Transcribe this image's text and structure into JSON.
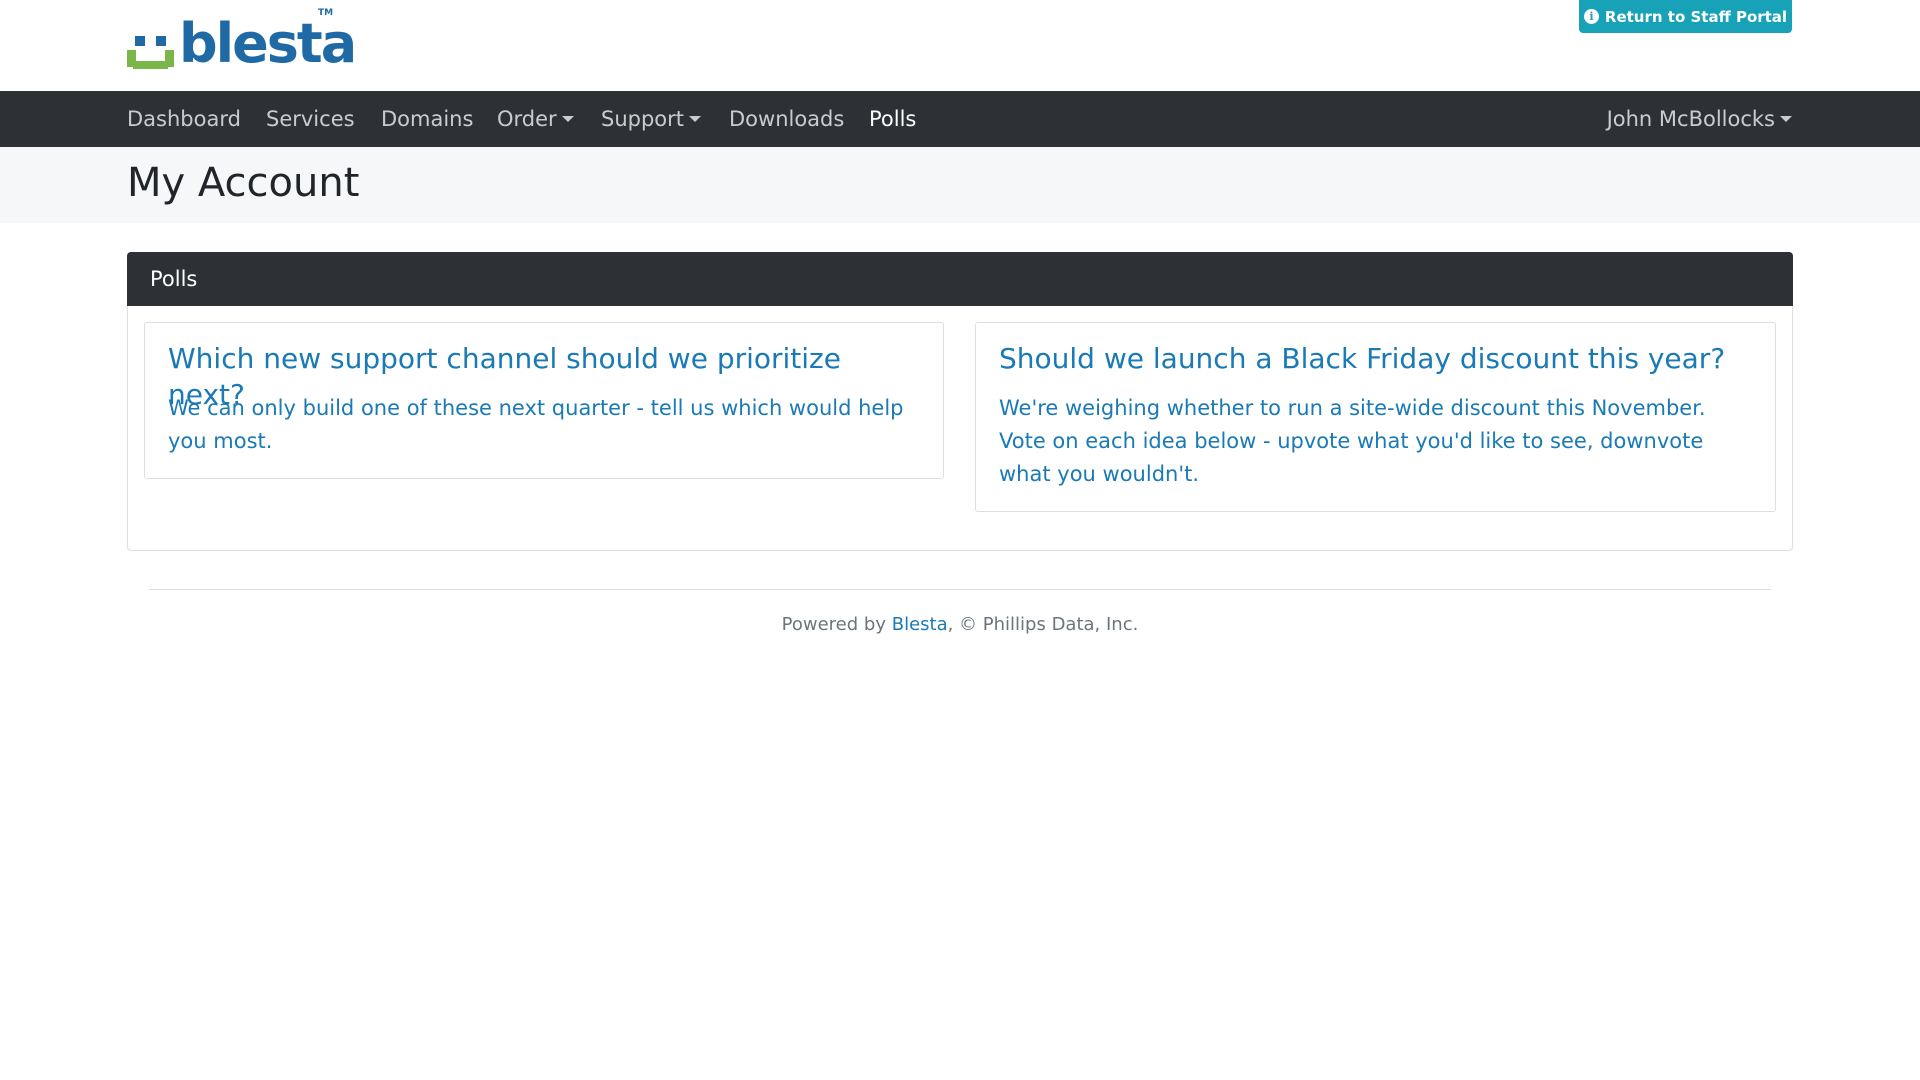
{
  "brand": {
    "name": "blesta",
    "trademark": "TM"
  },
  "header": {
    "staff_button_label": "Return to Staff Portal",
    "staff_button_icon": "info-circle-icon"
  },
  "nav": {
    "items": [
      {
        "label": "Dashboard",
        "dropdown": false,
        "active": false
      },
      {
        "label": "Services",
        "dropdown": false,
        "active": false
      },
      {
        "label": "Domains",
        "dropdown": false,
        "active": false
      },
      {
        "label": "Order",
        "dropdown": true,
        "active": false
      },
      {
        "label": "Support",
        "dropdown": true,
        "active": false
      },
      {
        "label": "Downloads",
        "dropdown": false,
        "active": false
      },
      {
        "label": "Polls",
        "dropdown": false,
        "active": true
      }
    ],
    "user_menu": "John McBollocks"
  },
  "page": {
    "title": "My Account"
  },
  "panel": {
    "title": "Polls",
    "polls": [
      {
        "question": "Which new support channel should we prioritize next?",
        "description": "We can only build one of these next quarter - tell us which would help you most."
      },
      {
        "question": "Should we launch a Black Friday discount this year?",
        "description": "We're weighing whether to run a site-wide discount this November. Vote on each idea below - upvote what you'd like to see, downvote what you wouldn't."
      }
    ]
  },
  "footer": {
    "prefix": "Powered by ",
    "link": "Blesta",
    "suffix": ", © Phillips Data, Inc."
  },
  "colors": {
    "navbar": "#2d3135",
    "accent": "#17a2b8",
    "link": "#1a7ab5",
    "brand_blue": "#1f6aa5",
    "brand_green": "#7ab648"
  }
}
